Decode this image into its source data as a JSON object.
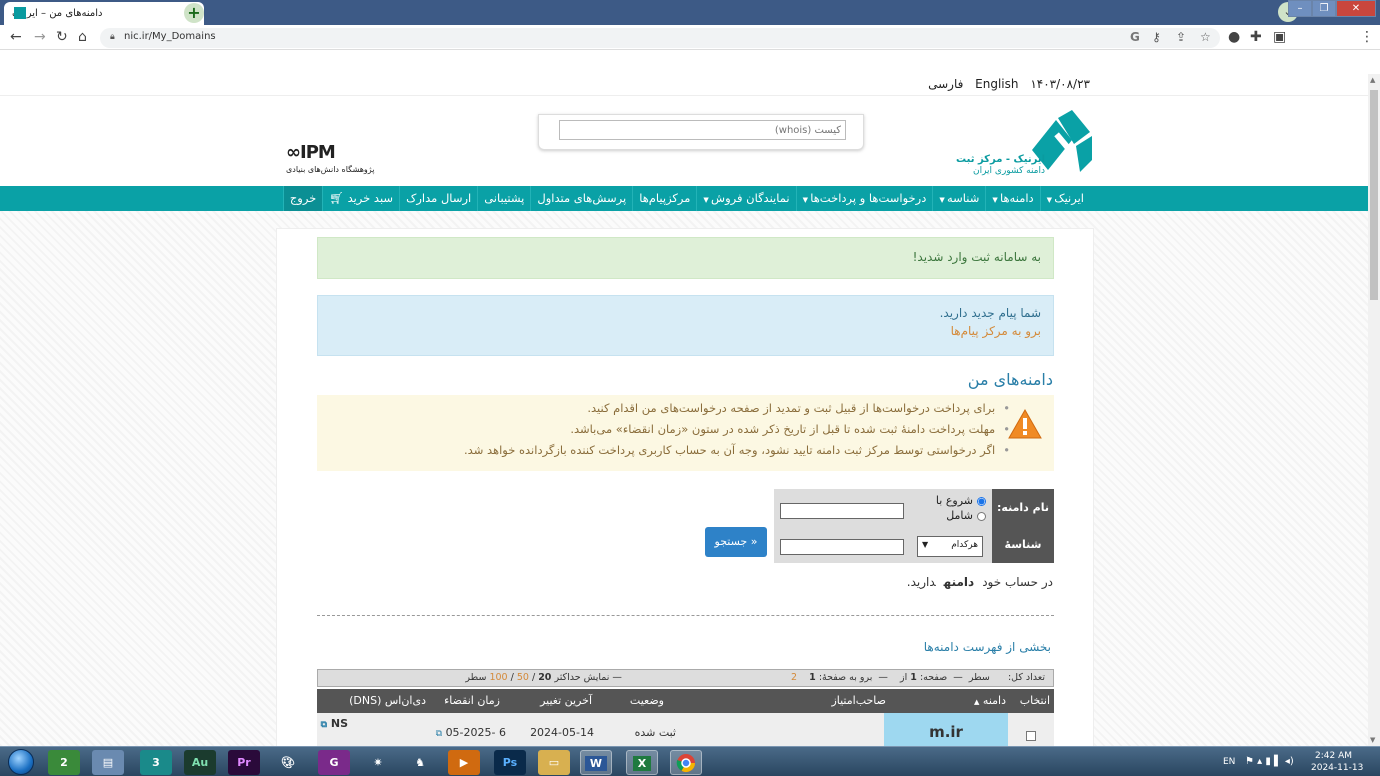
{
  "browser": {
    "tab_title": "دامنه‌های من – ایرنیک",
    "tab_close": "×",
    "new_tab": "+",
    "url": "nic.ir/My_Domains",
    "window_controls": [
      "–",
      "❐",
      "✕"
    ]
  },
  "topbar": {
    "date": "۱۴۰۳/۰۸/۲۳",
    "lang_en": "English",
    "lang_fa": "فارسی"
  },
  "header": {
    "whois_placeholder": "کیست (whois)",
    "irnic_line1": "ایرنیک - مرکز ثبت",
    "irnic_line2": "دامنه کشوری ایران",
    "ipm_logo": "IPM",
    "ipm_sub": "پژوهشگاه دانش‌های بنیادی"
  },
  "nav": {
    "items": [
      {
        "label": "ایرنیک",
        "caret": true
      },
      {
        "label": "دامنه‌ها",
        "caret": true
      },
      {
        "label": "شناسه",
        "caret": true
      },
      {
        "label": "درخواست‌ها و پرداخت‌ها",
        "caret": true
      },
      {
        "label": "نمایندگان فروش",
        "caret": true
      },
      {
        "label": "مرکزپیام‌ها",
        "caret": false
      },
      {
        "label": "پرسش‌های متداول",
        "caret": false
      },
      {
        "label": "پشتیبانی",
        "caret": false
      },
      {
        "label": "ارسال مدارک",
        "caret": false
      },
      {
        "label": "سبد خرید",
        "caret": false
      },
      {
        "label": "خروج",
        "caret": false
      }
    ]
  },
  "alerts": {
    "success": "به سامانه ثبت وارد شدید!",
    "info_text": "شما پیام جدید دارید.",
    "info_link": "برو به مرکز پیام‌ها"
  },
  "main": {
    "heading": "دامنه‌های من",
    "warnings": [
      "برای پرداخت درخواست‌ها از قبیل ثبت و تمدید از صفحه درخواست‌های من اقدام کنید.",
      "مهلت پرداخت دامنهٔ ثبت شده تا قبل از تاریخ ذکر شده در ستون «زمان انقضاء» می‌باشد.",
      "اگر درخواستی توسط مرکز ثبت دامنه تایید نشود، وجه آن به حساب کاربری پرداخت کننده بازگردانده خواهد شد."
    ]
  },
  "search": {
    "label_domain": "نام دامنه:",
    "label_handle": "شناسهٔ رابط:",
    "radio_starts": "شروع با",
    "radio_contains": "شامل",
    "select_value": "هرکدام",
    "button": "جستجو »"
  },
  "account": {
    "prefix": "در حساب خود",
    "bold": "دامنه",
    "suffix": "دارید."
  },
  "list": {
    "title": "بخشی از فهرست دامنه‌ها",
    "pager": {
      "total_label": "تعداد کل:",
      "rows_label": "سطر",
      "page_label": "صفحه:",
      "page_num": "1",
      "of_label": "از",
      "goto_label": "برو به صفحهٔ:",
      "goto_pages": "1",
      "goto_other": "2",
      "max_label": "نمایش حداکثر",
      "max_current": "20",
      "max_opt1": "50",
      "max_opt2": "100",
      "max_suffix": "سطر"
    },
    "columns": [
      "انتخاب",
      "دامنه",
      "صاحب‌امتیاز",
      "وضعیت",
      "آخرین تغییر",
      "زمان انقضاء",
      "دی‌ان‌اس (DNS)"
    ],
    "sort_mark": "▲",
    "rows": [
      {
        "domain": "m.ir",
        "status": "ثبت شده",
        "last_change": "2024-05-14",
        "expiry": "6 -05-2025",
        "dns": "NS"
      }
    ]
  },
  "taskbar": {
    "apps": [
      "2",
      "3",
      "Au",
      "Pr",
      "G",
      "Ps",
      "W",
      "X"
    ],
    "lang": "EN",
    "time": "2:42 AM",
    "date": "2024-11-13"
  },
  "colors": {
    "brand_teal": "#0aa1a6",
    "link_blue": "#2a7fa8",
    "success_bg": "#dff0d8",
    "info_bg": "#d9edf7",
    "warning_bg": "#fcf8e3"
  }
}
